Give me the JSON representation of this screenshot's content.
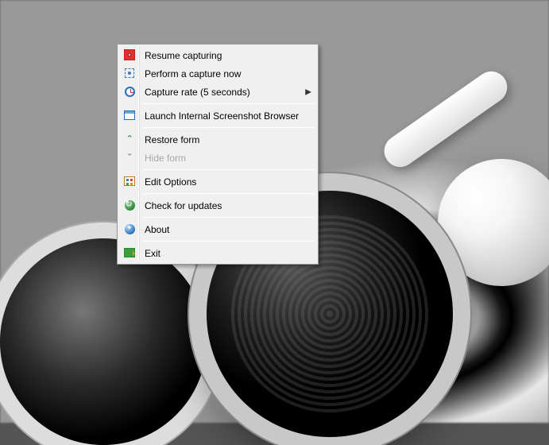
{
  "menu": {
    "resume": {
      "label": "Resume capturing"
    },
    "perform": {
      "label": "Perform a capture now"
    },
    "rate": {
      "label": "Capture rate (5 seconds)"
    },
    "launch": {
      "label": "Launch Internal Screenshot Browser"
    },
    "restore": {
      "label": "Restore form"
    },
    "hide": {
      "label": "Hide form"
    },
    "options": {
      "label": "Edit Options"
    },
    "updates": {
      "label": "Check for updates"
    },
    "about": {
      "label": "About"
    },
    "exit": {
      "label": "Exit"
    }
  }
}
